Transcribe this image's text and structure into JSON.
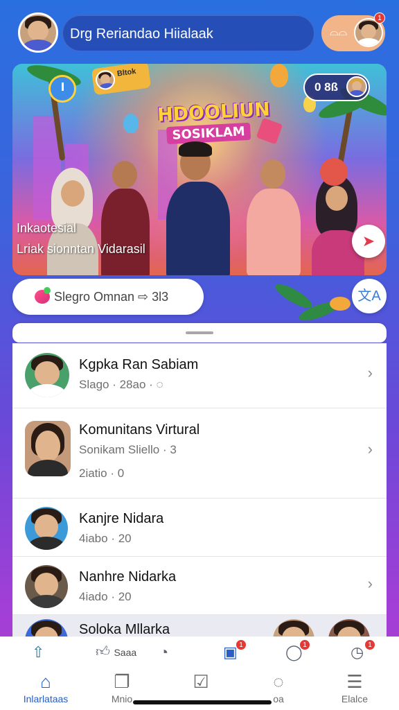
{
  "header": {
    "search_text": "Drg Reriandao Hiialaak",
    "pill_icon": "glasses-icon",
    "notification_count": "1"
  },
  "hero": {
    "chip_left_label": "Bltok",
    "logo_line1": "HDOOLIUN",
    "logo_line2": "SOSIKLAM",
    "chip_right_value": "0 8ß",
    "caption_line1": "Inkaotesial",
    "caption_line2": "Lriak sionntan Vidarasil",
    "fab_icon": "share-icon"
  },
  "stats": {
    "label": "Slegro Omnan ⇨ 3l3",
    "side_icon": "translate-icon"
  },
  "list": [
    {
      "title": "Kgpka Ran Sabiam",
      "sub": "Slago · 28ao · ◌"
    },
    {
      "title": "Komunitans Virtural",
      "sub": "Sonikam Sliello · 3",
      "sub2": "2iatio · 0"
    },
    {
      "title": "Kanjre Nidara",
      "sub": "4iabo · 20"
    },
    {
      "title": "Nanhre Nidarka",
      "sub": "4iado · 20"
    },
    {
      "title": "Soloka Mllarka"
    }
  ],
  "bottom_top": {
    "like_label": "Saaa",
    "badges": [
      "1",
      "1",
      "1"
    ]
  },
  "nav": [
    {
      "label": "Inlarlataas",
      "icon": "home-icon"
    },
    {
      "label": "Mnio",
      "icon": "layers-icon"
    },
    {
      "label": "",
      "icon": "check-icon"
    },
    {
      "label": "oa",
      "icon": "chat-icon"
    },
    {
      "label": "Elalce",
      "icon": "menu-icon"
    }
  ],
  "colors": {
    "accent": "#1f5dd0",
    "badge": "#e53935",
    "background_top": "#2a6fe0",
    "background_bottom": "#b03fd0"
  }
}
